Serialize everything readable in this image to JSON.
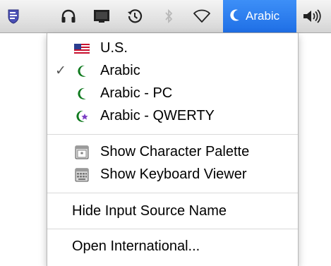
{
  "menubar": {
    "input_source_label": "Arabic",
    "items": [
      {
        "icon": "script-menu-icon"
      },
      {
        "icon": "headphones-icon"
      },
      {
        "icon": "display-icon"
      },
      {
        "icon": "time-machine-icon"
      },
      {
        "icon": "bluetooth-icon"
      },
      {
        "icon": "wifi-icon"
      },
      {
        "icon": "input-source-icon"
      },
      {
        "icon": "volume-icon"
      }
    ]
  },
  "menu": {
    "sources": [
      {
        "label": "U.S.",
        "icon": "us-flag-icon",
        "checked": false
      },
      {
        "label": "Arabic",
        "icon": "crescent-icon",
        "checked": true,
        "check_glyph": "✓"
      },
      {
        "label": "Arabic - PC",
        "icon": "crescent-icon",
        "checked": false
      },
      {
        "label": "Arabic - QWERTY",
        "icon": "crescent-star-icon",
        "checked": false
      }
    ],
    "palette_items": [
      {
        "label": "Show Character Palette",
        "icon": "character-palette-icon"
      },
      {
        "label": "Show Keyboard Viewer",
        "icon": "keyboard-viewer-icon"
      }
    ],
    "hide_label": "Hide Input Source Name",
    "open_label": "Open International..."
  },
  "colors": {
    "selection_blue": "#2a7cf0",
    "crescent_green": "#0f7a1e",
    "star_purple": "#7b3fc4"
  }
}
